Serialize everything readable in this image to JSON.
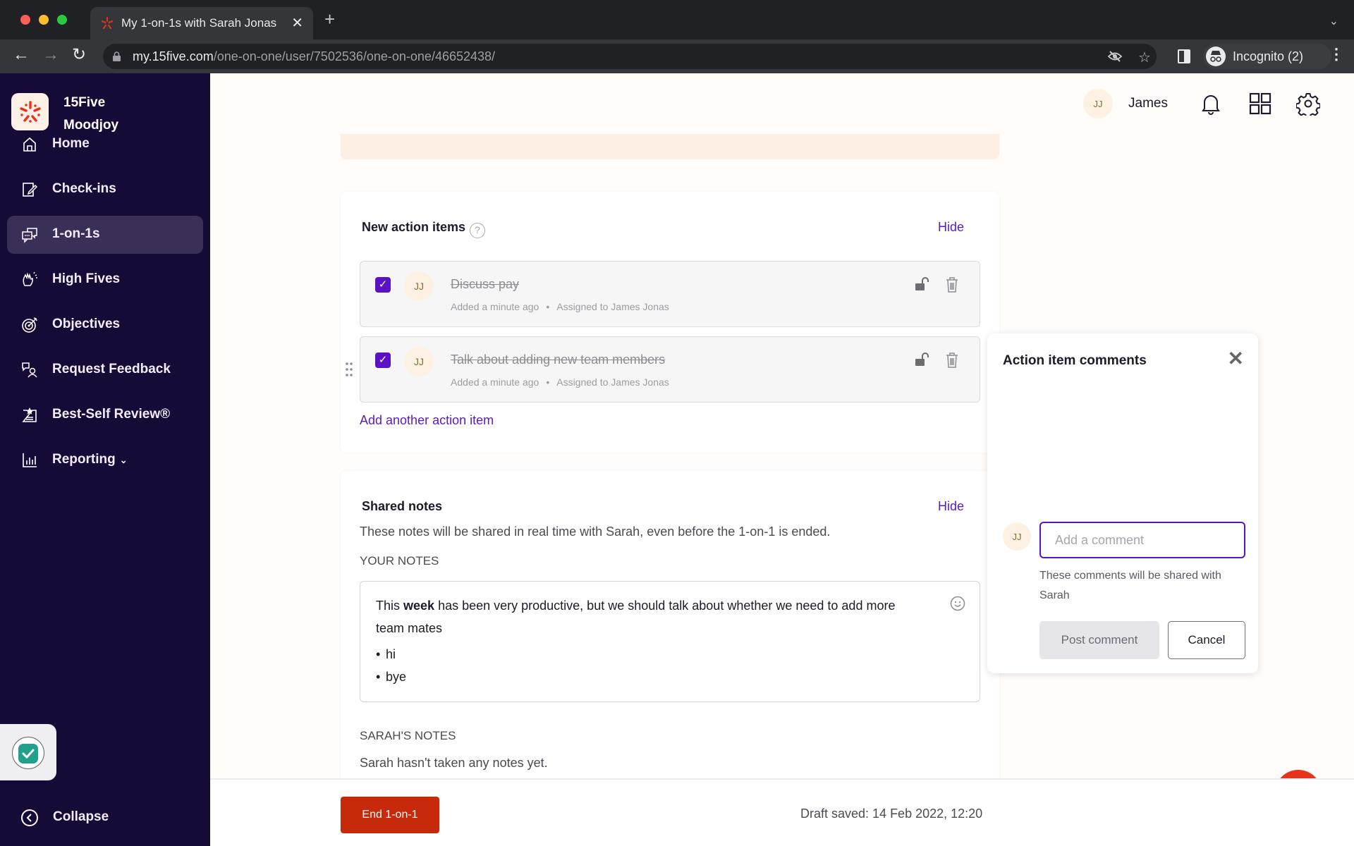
{
  "browser": {
    "tab_title": "My 1-on-1s with Sarah Jonas",
    "url_host": "my.15five.com",
    "url_path": "/one-on-one/user/7502536/one-on-one/46652438/",
    "profile_label": "Incognito (2)"
  },
  "brand": {
    "line1": "15Five",
    "line2": "Moodjoy",
    "accent": "#e8321a"
  },
  "sidebar": {
    "items": [
      {
        "label": "Home",
        "icon": "home-icon"
      },
      {
        "label": "Check-ins",
        "icon": "check-ins-icon"
      },
      {
        "label": "1-on-1s",
        "icon": "chat-bubbles-icon",
        "active": true
      },
      {
        "label": "High Fives",
        "icon": "high-five-icon"
      },
      {
        "label": "Objectives",
        "icon": "target-icon"
      },
      {
        "label": "Request Feedback",
        "icon": "request-feedback-icon"
      },
      {
        "label": "Best-Self Review®",
        "icon": "review-star-icon"
      },
      {
        "label": "Reporting",
        "icon": "bar-chart-icon",
        "has_dropdown": true
      }
    ],
    "collapse_label": "Collapse"
  },
  "topbar": {
    "user_initials": "JJ",
    "user_name": "James"
  },
  "action_items": {
    "title": "New action items",
    "hide_label": "Hide",
    "items": [
      {
        "title": "Discuss pay",
        "initials": "JJ",
        "added": "Added a minute ago",
        "assigned": "Assigned to James Jonas",
        "completed": true
      },
      {
        "title": "Talk about adding new team members",
        "initials": "JJ",
        "added": "Added a minute ago",
        "assigned": "Assigned to James Jonas",
        "completed": true
      }
    ],
    "add_label": "Add another action item"
  },
  "shared_notes": {
    "title": "Shared notes",
    "hide_label": "Hide",
    "description": "These notes will be shared in real time with Sarah, even before the 1-on-1 is ended.",
    "your_notes_label": "YOUR NOTES",
    "your_notes": {
      "pre": "This ",
      "bold": "week",
      "post": " has been very productive, but we should talk about whether we need to add more team mates",
      "bullets": [
        "hi",
        "bye"
      ]
    },
    "sarah_notes_label": "SARAH'S NOTES",
    "sarah_notes_empty": "Sarah hasn't taken any notes yet."
  },
  "footer": {
    "end_label": "End 1-on-1",
    "draft_status": "Draft saved: 14 Feb 2022, 12:20"
  },
  "comments_popover": {
    "title": "Action item comments",
    "initials": "JJ",
    "input_value": "",
    "input_placeholder": "Add a comment",
    "hint": "These comments will be shared with Sarah",
    "post_label": "Post comment",
    "cancel_label": "Cancel"
  }
}
